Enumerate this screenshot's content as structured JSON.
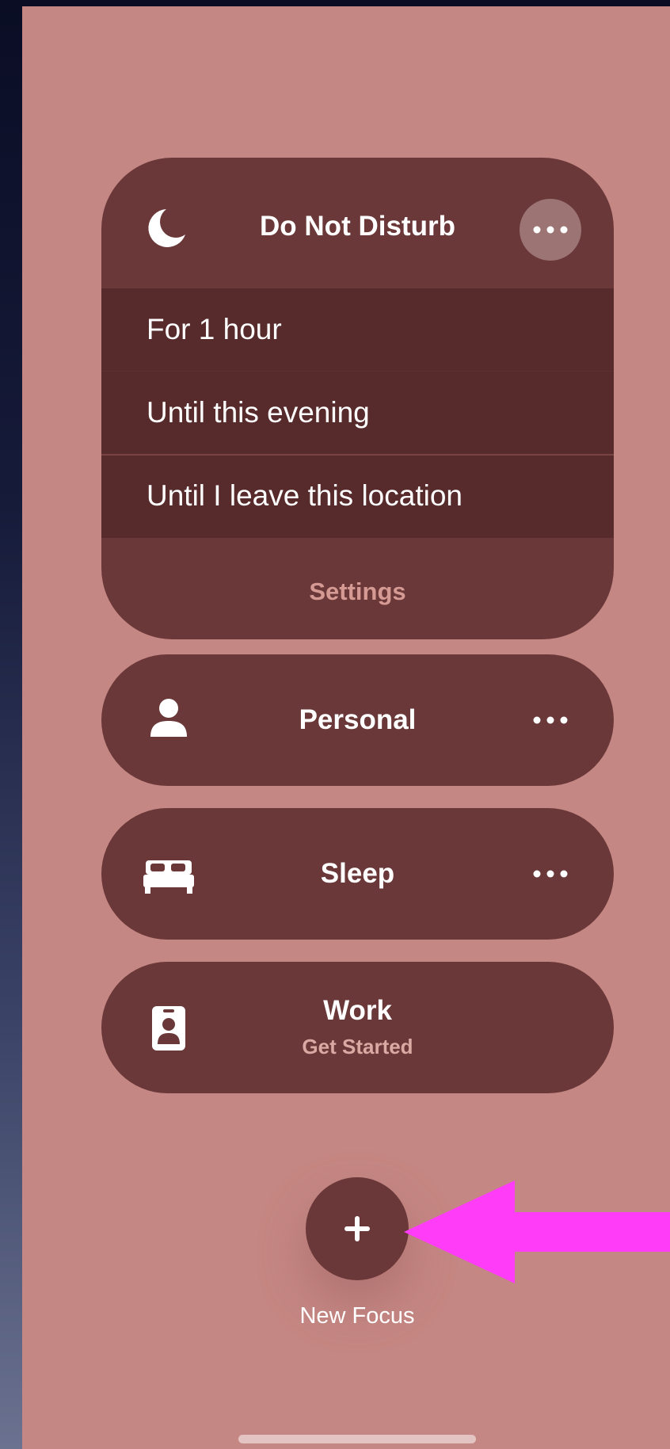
{
  "colors": {
    "background": "#c58783",
    "card": "#6a3838",
    "options_bg": "#572b2c",
    "settings_text": "#d59a93",
    "arrow": "#ff3cf8",
    "white": "#ffffff"
  },
  "dnd": {
    "title": "Do Not Disturb",
    "icon": "moon-icon",
    "more_icon": "ellipsis-icon",
    "options": [
      "For 1 hour",
      "Until this evening",
      "Until I leave this location"
    ],
    "settings_label": "Settings"
  },
  "focus_modes": [
    {
      "name": "Personal",
      "icon": "person-icon",
      "more_icon": "ellipsis-icon"
    },
    {
      "name": "Sleep",
      "icon": "bed-icon",
      "more_icon": "ellipsis-icon"
    },
    {
      "name": "Work",
      "icon": "id-badge-icon",
      "subtitle": "Get Started"
    }
  ],
  "new_focus": {
    "label": "New Focus",
    "icon": "plus-icon"
  },
  "annotation": {
    "icon": "arrow-left-icon"
  }
}
